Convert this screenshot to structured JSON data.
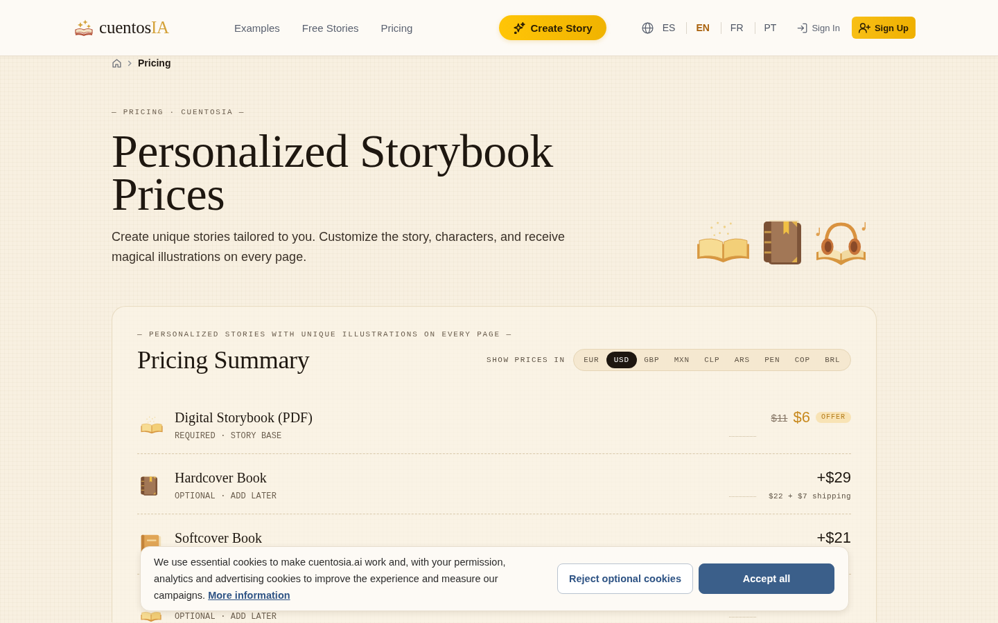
{
  "header": {
    "logo": {
      "name": "cuentos",
      "accent": "IA"
    },
    "nav": [
      "Examples",
      "Free Stories",
      "Pricing"
    ],
    "cta": "Create Story",
    "languages": [
      {
        "code": "ES",
        "selected": false
      },
      {
        "code": "EN",
        "selected": true
      },
      {
        "code": "FR",
        "selected": false
      },
      {
        "code": "PT",
        "selected": false
      }
    ],
    "sign_in": "Sign In",
    "sign_up": "Sign Up"
  },
  "breadcrumb": {
    "current": "Pricing"
  },
  "hero": {
    "eyebrow": "— PRICING · CUENTOSIA —",
    "title": "Personalized Storybook Prices",
    "description": "Create unique stories tailored to you. Customize the story, characters, and receive magical illustrations on every page."
  },
  "pricing": {
    "eyebrow": "— PERSONALIZED STORIES WITH UNIQUE ILLUSTRATIONS ON EVERY PAGE —",
    "title": "Pricing Summary",
    "currency_label": "SHOW PRICES IN",
    "currencies": [
      {
        "code": "EUR",
        "selected": false
      },
      {
        "code": "USD",
        "selected": true
      },
      {
        "code": "GBP",
        "selected": false
      },
      {
        "code": "MXN",
        "selected": false
      },
      {
        "code": "CLP",
        "selected": false
      },
      {
        "code": "ARS",
        "selected": false
      },
      {
        "code": "PEN",
        "selected": false
      },
      {
        "code": "COP",
        "selected": false
      },
      {
        "code": "BRL",
        "selected": false
      }
    ],
    "items": [
      {
        "title": "Digital Storybook (PDF)",
        "tags": "REQUIRED · STORY BASE",
        "old_price": "$11",
        "price": "$6",
        "badge": "OFFER"
      },
      {
        "title": "Hardcover Book",
        "tags": "OPTIONAL · ADD LATER",
        "price": "+$29",
        "note": "$22 + $7 shipping"
      },
      {
        "title": "Softcover Book",
        "price": "+$21"
      },
      {
        "tags": "OPTIONAL · ADD LATER"
      }
    ]
  },
  "cookie_banner": {
    "text": "We use essential cookies to make cuentosia.ai work and, with your permission, analytics and advertising cookies to improve the experience and measure our campaigns.",
    "link": "More information",
    "buttons": [
      {
        "label": "Reject optional cookies",
        "kind": "secondary"
      },
      {
        "label": "Accept all",
        "kind": "primary"
      }
    ]
  }
}
